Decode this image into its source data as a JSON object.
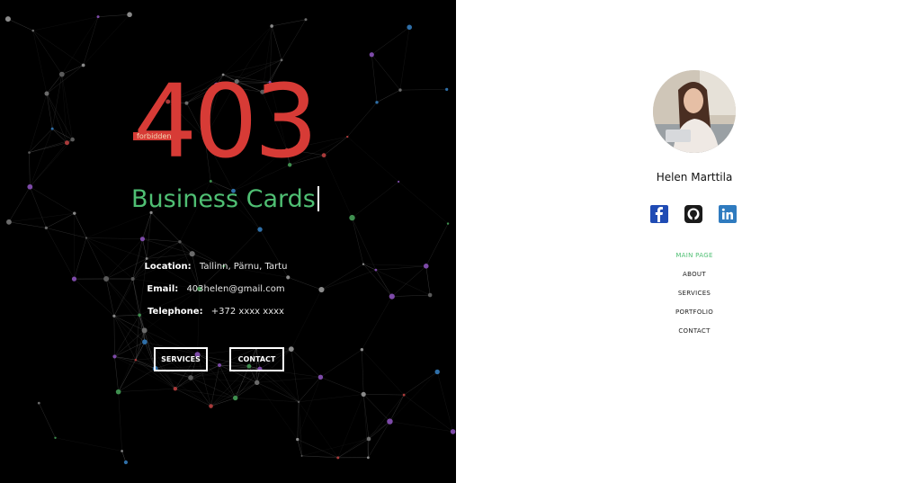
{
  "hero": {
    "logo_number": "403",
    "logo_tag": "forbidden",
    "headline": "Business Cards",
    "contact": [
      {
        "label": "Location:",
        "value": "Tallinn, Pärnu, Tartu"
      },
      {
        "label": "Email:",
        "value": "403helen@gmail.com"
      },
      {
        "label": "Telephone:",
        "value": "+372 xxxx xxxx"
      }
    ],
    "buttons": {
      "services": "SERVICES",
      "contact": "CONTACT"
    },
    "colors": {
      "background": "#000000",
      "logo": "#d73b36",
      "headline": "#4fbf73"
    }
  },
  "sidebar": {
    "name": "Helen Marttila",
    "avatar_icon": "profile-photo",
    "social": [
      {
        "icon": "facebook-icon"
      },
      {
        "icon": "github-icon"
      },
      {
        "icon": "linkedin-icon"
      }
    ],
    "nav": [
      {
        "label": "MAIN PAGE",
        "active": true
      },
      {
        "label": "ABOUT",
        "active": false
      },
      {
        "label": "SERVICES",
        "active": false
      },
      {
        "label": "PORTFOLIO",
        "active": false
      },
      {
        "label": "CONTACT",
        "active": false
      }
    ],
    "colors": {
      "accent": "#4fbf73",
      "facebook": "#1f4bb4",
      "github": "#1a1a1a",
      "linkedin": "#2f7bbf"
    }
  }
}
